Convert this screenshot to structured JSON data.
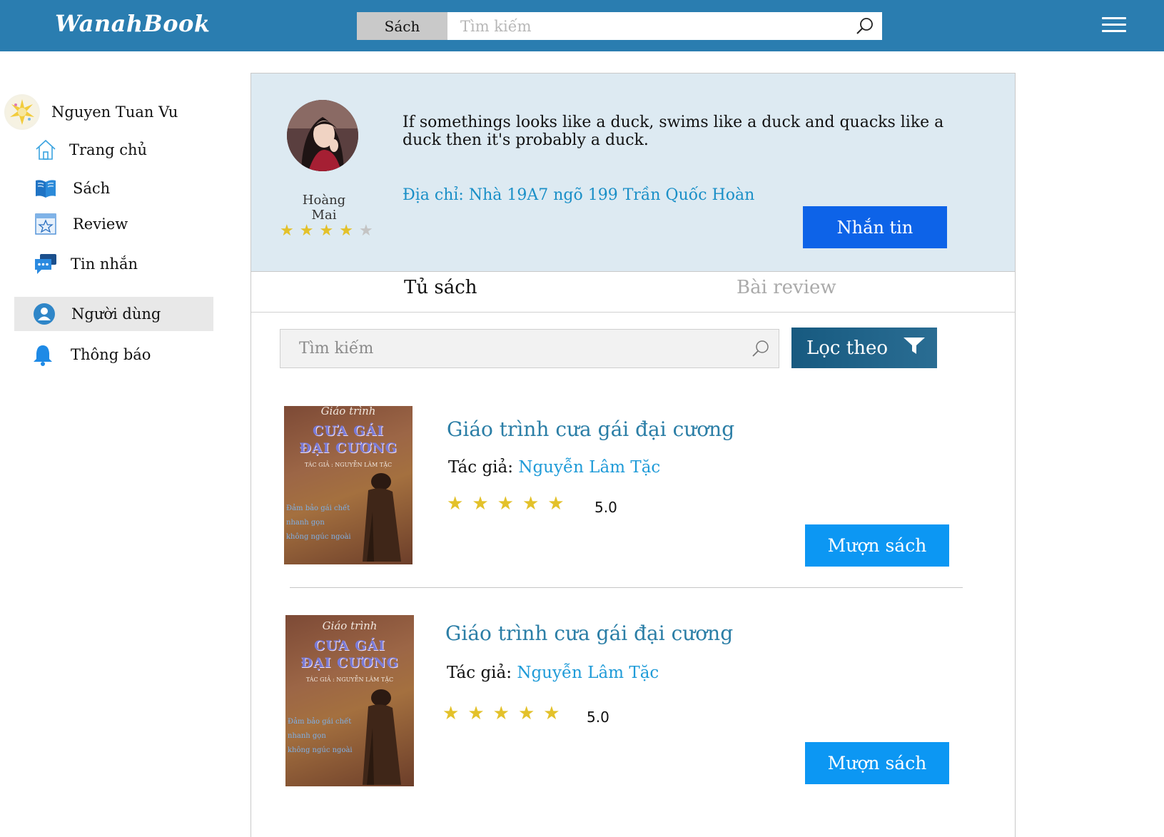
{
  "header": {
    "logo": "WanahBook",
    "search_category": "Sách",
    "search_placeholder": "Tìm kiếm"
  },
  "sidebar": {
    "user_name": "Nguyen Tuan Vu",
    "items": [
      {
        "label": "Trang chủ",
        "icon": "home-icon"
      },
      {
        "label": "Sách",
        "icon": "book-icon"
      },
      {
        "label": "Review",
        "icon": "review-icon"
      },
      {
        "label": "Tin nhắn",
        "icon": "chat-icon"
      },
      {
        "label": "Người dùng",
        "icon": "user-icon",
        "active": true
      },
      {
        "label": "Thông báo",
        "icon": "bell-icon"
      }
    ]
  },
  "profile_card": {
    "name": "Hoàng Mai",
    "rating": 4,
    "max_rating": 5,
    "quote": "If somethings looks like a duck, swims like a duck and quacks like a duck then it's probably a duck.",
    "address": "Địa chỉ: Nhà 19A7 ngõ 199 Trần Quốc Hoàn",
    "message_button": "Nhắn tin"
  },
  "tabs": [
    {
      "label": "Tủ sách",
      "active": true
    },
    {
      "label": "Bài review",
      "active": false
    }
  ],
  "filter": {
    "search_placeholder": "Tìm kiếm",
    "filter_button": "Lọc theo"
  },
  "books": [
    {
      "title": "Giáo trình cưa gái đại cương",
      "author_label": "Tác giả:",
      "author": "Nguyễn Lâm Tặc",
      "rating": "5.0",
      "button": "Mượn sách",
      "cover": {
        "line1": "Giáo trình",
        "line2": "CƯA GÁI",
        "line3": "ĐẠI CƯƠNG",
        "author": "TÁC GIẢ : NGUYỄN LÂM TẶC",
        "side": [
          "Đảm bảo gái chết",
          "nhanh gọn",
          "không ngúc ngoài"
        ]
      }
    },
    {
      "title": "Giáo trình cưa gái đại cương",
      "author_label": "Tác giả:",
      "author": "Nguyễn Lâm Tặc",
      "rating": "5.0",
      "button": "Mượn sách",
      "cover": {
        "line1": "Giáo trình",
        "line2": "CƯA GÁI",
        "line3": "ĐẠI CƯƠNG",
        "author": "TÁC GIẢ : NGUYỄN LÂM TẶC",
        "side": [
          "Đảm bảo gái chết",
          "nhanh gọn",
          "không ngúc ngoài"
        ]
      }
    }
  ],
  "colors": {
    "header": "#2a7db0",
    "card_bg": "#ddeaf2",
    "message_button": "#0d63e8",
    "borrow_button": "#0c97f3",
    "star": "#e3c12a",
    "title": "#2b7ea6",
    "author": "#1f9bd8"
  }
}
